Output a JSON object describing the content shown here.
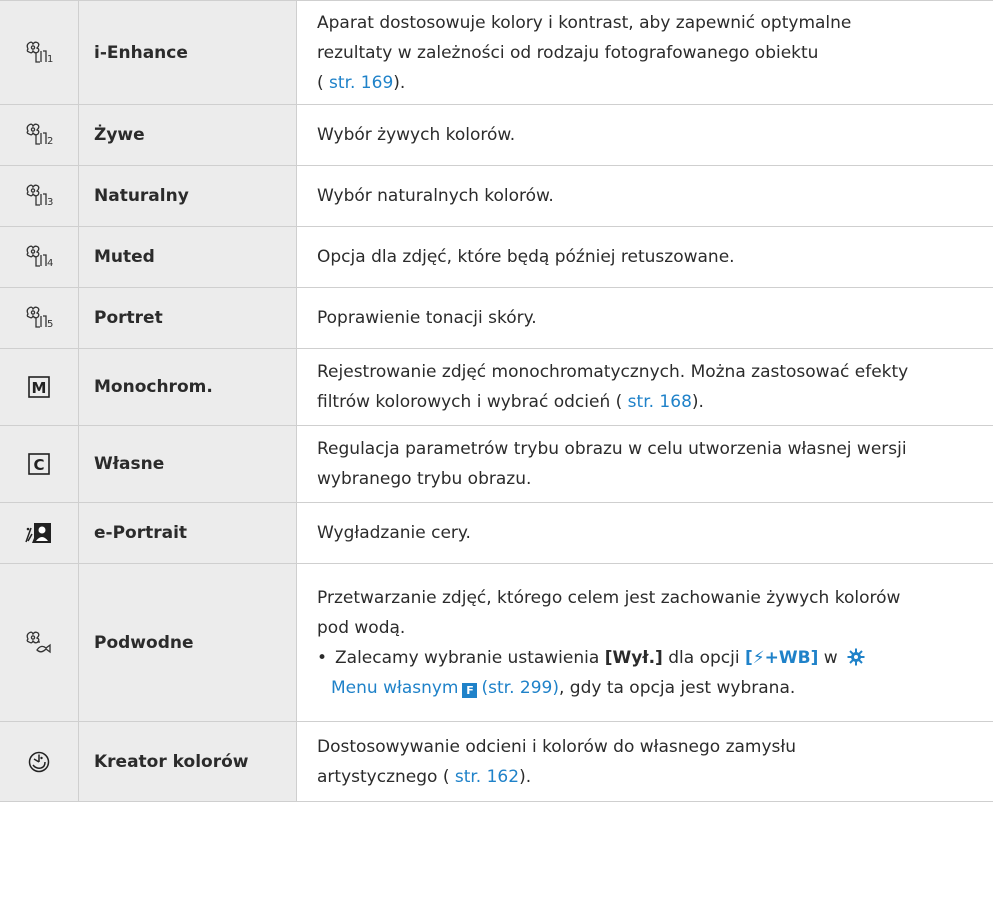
{
  "colors": {
    "link": "#1f82c9",
    "cell_bg": "#ececec",
    "border": "#cfcfcf"
  },
  "rows": [
    {
      "icon": "picture-mode-1-icon",
      "name": "i-Enhance",
      "desc": [
        "Aparat dostosowuje kolory i kontrast, aby zapewnić optymalne",
        "rezultaty w zależności od rodzaju fotografowanego obiektu"
      ],
      "ref_prefix": "( ",
      "ref_link": "str. 169",
      "ref_suffix": ")."
    },
    {
      "icon": "picture-mode-2-icon",
      "name": "Żywe",
      "desc": [
        "Wybór żywych kolorów."
      ]
    },
    {
      "icon": "picture-mode-3-icon",
      "name": "Naturalny",
      "desc": [
        "Wybór naturalnych kolorów."
      ]
    },
    {
      "icon": "picture-mode-4-icon",
      "name": "Muted",
      "desc": [
        "Opcja dla zdjęć, które będą później retuszowane."
      ]
    },
    {
      "icon": "picture-mode-5-icon",
      "name": "Portret",
      "desc": [
        "Poprawienie tonacji skóry."
      ]
    },
    {
      "icon": "monochrome-icon",
      "glyph": "M",
      "name": "Monochrom.",
      "desc": [
        "Rejestrowanie zdjęć monochromatycznych. Można zastosować efekty"
      ],
      "line2_prefix": "filtrów kolorowych i wybrać odcień ( ",
      "ref_link": "str. 168",
      "ref_suffix": ")."
    },
    {
      "icon": "custom-icon",
      "glyph": "C",
      "name": "Własne",
      "desc": [
        "Regulacja parametrów trybu obrazu w celu utworzenia własnej wersji",
        "wybranego trybu obrazu."
      ]
    },
    {
      "icon": "e-portrait-icon",
      "name": "e-Portrait",
      "desc": [
        "Wygładzanie cery."
      ]
    },
    {
      "icon": "underwater-icon",
      "name": "Podwodne",
      "desc": [
        "Przetwarzanie zdjęć, którego celem jest zachowanie żywych kolorów",
        "pod wodą."
      ],
      "bullet": {
        "mark": "•",
        "text1": "Zalecamy wybranie ustawienia ",
        "bold1": "[Wył.]",
        "text2": " dla opcji ",
        "bracket": "[⚡+WB]",
        "text3": " w ",
        "menu_link": "Menu własnym",
        "fbox": "F",
        "ref_link": "(str. 299)",
        "text4": ", gdy ta opcja jest wybrana."
      }
    },
    {
      "icon": "color-creator-icon",
      "name": "Kreator kolorów",
      "desc": [
        "Dostosowywanie odcieni i kolorów do własnego zamysłu"
      ],
      "line2_prefix": "artystycznego ( ",
      "ref_link": "str. 162",
      "ref_suffix": ")."
    }
  ]
}
